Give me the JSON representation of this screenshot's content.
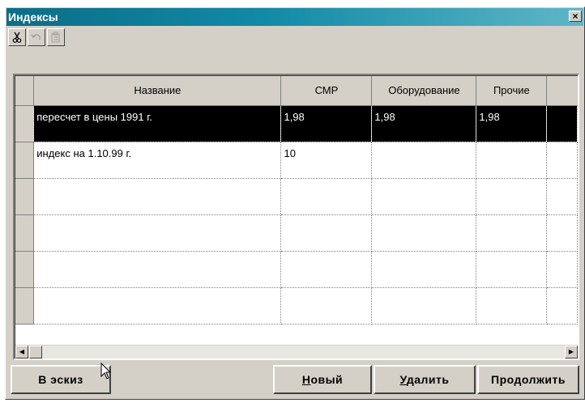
{
  "window": {
    "title": "Индексы",
    "close_label": "×"
  },
  "toolbar": {
    "buttons": [
      {
        "icon": "scissors-icon",
        "enabled": true
      },
      {
        "icon": "undo-icon",
        "enabled": false
      },
      {
        "icon": "paste-icon",
        "enabled": false
      }
    ]
  },
  "grid": {
    "columns": [
      "Название",
      "СМР",
      "Оборудование",
      "Прочие"
    ],
    "rows": [
      [
        "пересчет в цены 1991 г.",
        "1,98",
        "1,98",
        "1,98"
      ],
      [
        "индекс на 1.10.99 г.",
        "10",
        "",
        ""
      ],
      [
        "",
        "",
        "",
        ""
      ],
      [
        "",
        "",
        "",
        ""
      ],
      [
        "",
        "",
        "",
        ""
      ],
      [
        "",
        "",
        "",
        ""
      ]
    ],
    "selected_row": 0
  },
  "buttons": {
    "sketch": "В эскиз",
    "new_mnemonic": "Н",
    "new_rest": "овый",
    "delete_mnemonic": "У",
    "delete_rest": "далить",
    "continue": "Продолжить"
  },
  "colors": {
    "title_start": "#0c6d87",
    "title_end": "#5fb6c7",
    "selection": "#000000"
  }
}
